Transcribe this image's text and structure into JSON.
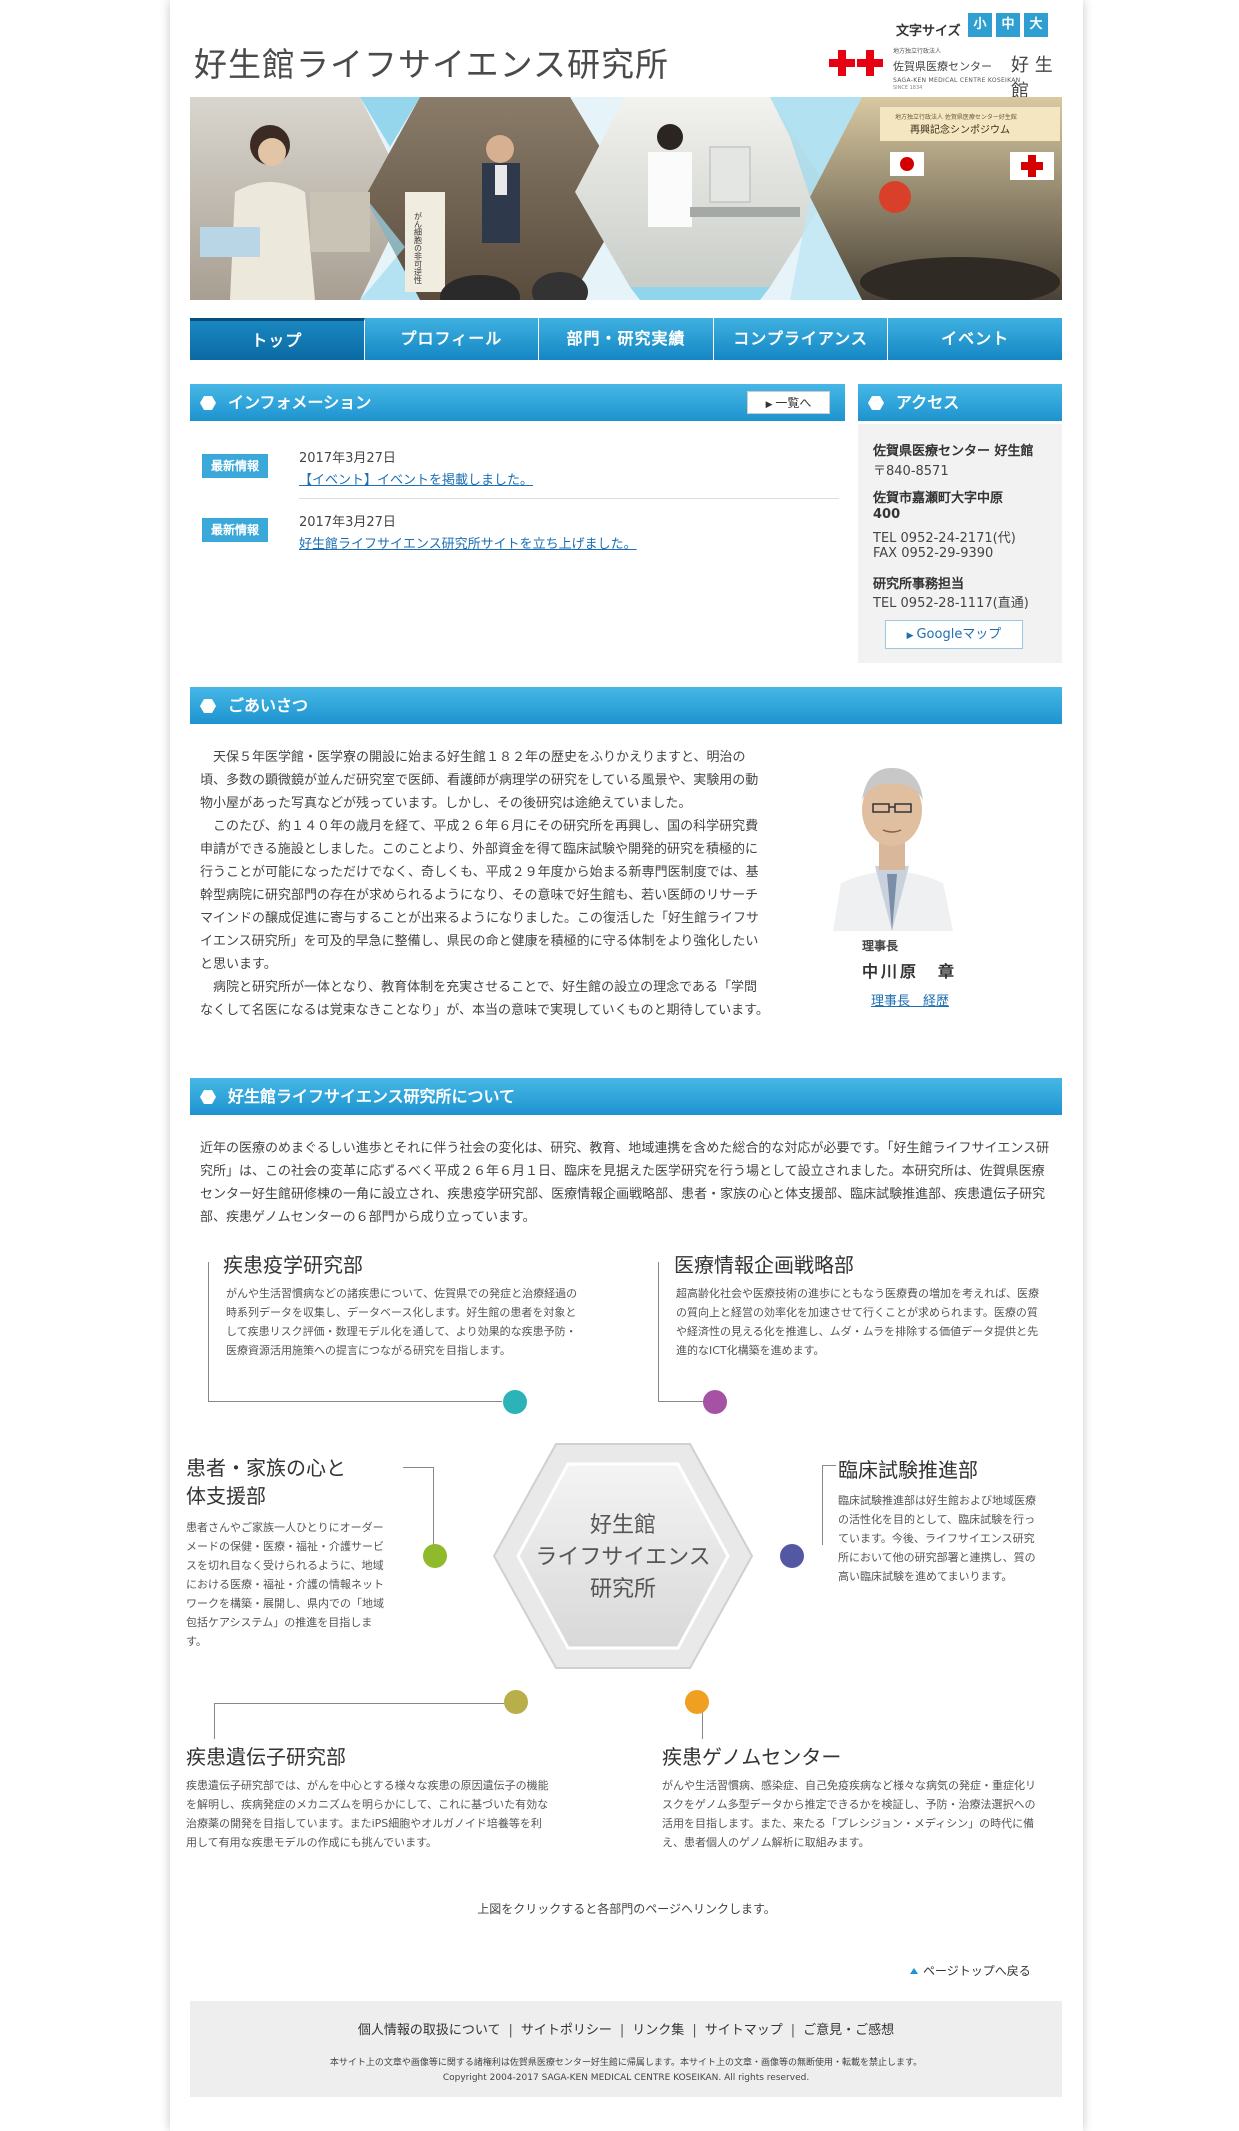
{
  "header": {
    "site_title": "好生館ライフサイエンス研究所",
    "font_size_label": "文字サイズ",
    "font_sizes": [
      "小",
      "中",
      "大"
    ],
    "logo": {
      "sub_top": "地方独立行政法人",
      "hospital": "佐賀県医療センター",
      "name": "好 生 館",
      "english": "SAGA-KEN MEDICAL CENTRE KOSEIKAN",
      "since": "SINCE 1834"
    }
  },
  "hero": {
    "sign_text": "がん細胞の非可逆性",
    "banner_line1": "地方独立行政法人 佐賀県医療センター好生館",
    "banner_line2": "再興記念シンポジウム"
  },
  "nav": {
    "items": [
      "トップ",
      "プロフィール",
      "部門・研究実績",
      "コンプライアンス",
      "イベント"
    ]
  },
  "info": {
    "heading": "インフォメーション",
    "more_label": "一覧へ",
    "items": [
      {
        "badge": "最新情報",
        "date": "2017年3月27日",
        "text": "【イベント】イベントを掲載しました。"
      },
      {
        "badge": "最新情報",
        "date": "2017年3月27日",
        "text": "好生館ライフサイエンス研究所サイトを立ち上げました。"
      }
    ]
  },
  "access": {
    "heading": "アクセス",
    "org": "佐賀県医療センター 好生館",
    "postal": "〒840-8571",
    "address1": "佐賀市嘉瀬町大字中原",
    "address2": "400",
    "tel": "TEL 0952-24-2171(代)",
    "fax": "FAX 0952-29-9390",
    "office_label": "研究所事務担当",
    "office_tel": "TEL 0952-28-1117(直通)",
    "map_button": "Googleマップ"
  },
  "greeting": {
    "heading": "ごあいさつ",
    "paragraphs": [
      "天保５年医学館・医学寮の開設に始まる好生館１８２年の歴史をふりかえりますと、明治の頃、多数の顕微鏡が並んだ研究室で医師、看護師が病理学の研究をしている風景や、実験用の動物小屋があった写真などが残っています。しかし、その後研究は途絶えていました。",
      "このたび、約１４０年の歳月を経て、平成２６年６月にその研究所を再興し、国の科学研究費申請ができる施設としました。このことより、外部資金を得て臨床試験や開発的研究を積極的に行うことが可能になっただけでなく、奇しくも、平成２９年度から始まる新専門医制度では、基幹型病院に研究部門の存在が求められるようになり、その意味で好生館も、若い医師のリサーチマインドの醸成促進に寄与することが出来るようになりました。この復活した「好生館ライフサイエンス研究所」を可及的早急に整備し、県民の命と健康を積極的に守る体制をより強化したいと思います。",
      "病院と研究所が一体となり、教育体制を充実させることで、好生館の設立の理念である「学問なくして名医になるは覚束なきことなり」が、本当の意味で実現していくものと期待しています。"
    ],
    "role": "理事長",
    "name": "中川原　章",
    "bio_link": "理事長　経歴"
  },
  "about": {
    "heading": "好生館ライフサイエンス研究所について",
    "text": "近年の医療のめまぐるしい進歩とそれに伴う社会の変化は、研究、教育、地域連携を含めた総合的な対応が必要です。「好生館ライフサイエンス研究所」は、この社会の変革に応ずるべく平成２６年６月１日、臨床を見据えた医学研究を行う場として設立されました。本研究所は、佐賀県医療センター好生館研修棟の一角に設立され、疾患疫学研究部、医療情報企画戦略部、患者・家族の心と体支援部、臨床試験推進部、疾患遺伝子研究部、疾患ゲノムセンターの６部門から成り立っています。",
    "center_label": [
      "好生館",
      "ライフサイエンス",
      "研究所"
    ],
    "departments": [
      {
        "title": "疾患疫学研究部",
        "desc": "がんや生活習慣病などの諸疾患について、佐賀県での発症と治療経過の時系列データを収集し、データベース化します。好生館の患者を対象として疾患リスク評価・数理モデル化を通して、より効果的な疾患予防・医療資源活用施策への提言につながる研究を目指します。",
        "color": "#2bb3b8"
      },
      {
        "title": "医療情報企画戦略部",
        "desc": "超高齢化社会や医療技術の進歩にともなう医療費の増加を考えれば、医療の質向上と経営の効率化を加速させて行くことが求められます。医療の質や経済性の見える化を推進し、ムダ・ムラを排除する価値データ提供と先進的なICT化構築を進めます。",
        "color": "#a552a5"
      },
      {
        "title": "患者・家族の心と\n体支援部",
        "desc": "患者さんやご家族一人ひとりにオーダーメードの保健・医療・福祉・介護サービスを切れ目なく受けられるように、地域における医療・福祉・介護の情報ネットワークを構築・展開し、県内での「地域包括ケアシステム」の推進を目指します。",
        "color": "#8fba2c"
      },
      {
        "title": "臨床試験推進部",
        "desc": "臨床試験推進部は好生館および地域医療の活性化を目的として、臨床試験を行っています。今後、ライフサイエンス研究所において他の研究部署と連携し、質の高い臨床試験を進めてまいります。",
        "color": "#5458a3"
      },
      {
        "title": "疾患遺伝子研究部",
        "desc": "疾患遺伝子研究部では、がんを中心とする様々な疾患の原因遺伝子の機能を解明し、疾病発症のメカニズムを明らかにして、これに基づいた有効な治療薬の開発を目指しています。またiPS細胞やオルガノイド培養等を利用して有用な疾患モデルの作成にも挑んでいます。",
        "color": "#b8ae4a"
      },
      {
        "title": "疾患ゲノムセンター",
        "desc": "がんや生活習慣病、感染症、自己免疫疾病など様々な病気の発症・重症化リスクをゲノム多型データから推定できるかを検証し、予防・治療法選択への活用を目指します。また、来たる「プレシジョン・メディシン」の時代に備え、患者個人のゲノム解析に取組みます。",
        "color": "#f0a020"
      }
    ],
    "click_note": "上図をクリックすると各部門のページへリンクします。"
  },
  "page_top": "ページトップへ戻る",
  "footer": {
    "links": [
      "個人情報の取扱について",
      "サイトポリシー",
      "リンク集",
      "サイトマップ",
      "ご意見・ご感想"
    ],
    "note": "本サイト上の文章や画像等に関する諸権利は佐賀県医療センター好生館に帰属します。本サイト上の文章・画像等の無断使用・転載を禁止します。",
    "copyright": "Copyright 2004-2017 SAGA-KEN MEDICAL CENTRE KOSEIKAN. All rights reserved."
  },
  "colors": {
    "accent_blue": "#1e93cf",
    "badge_blue": "#3aa8d8",
    "logo_red": "#e60012"
  }
}
